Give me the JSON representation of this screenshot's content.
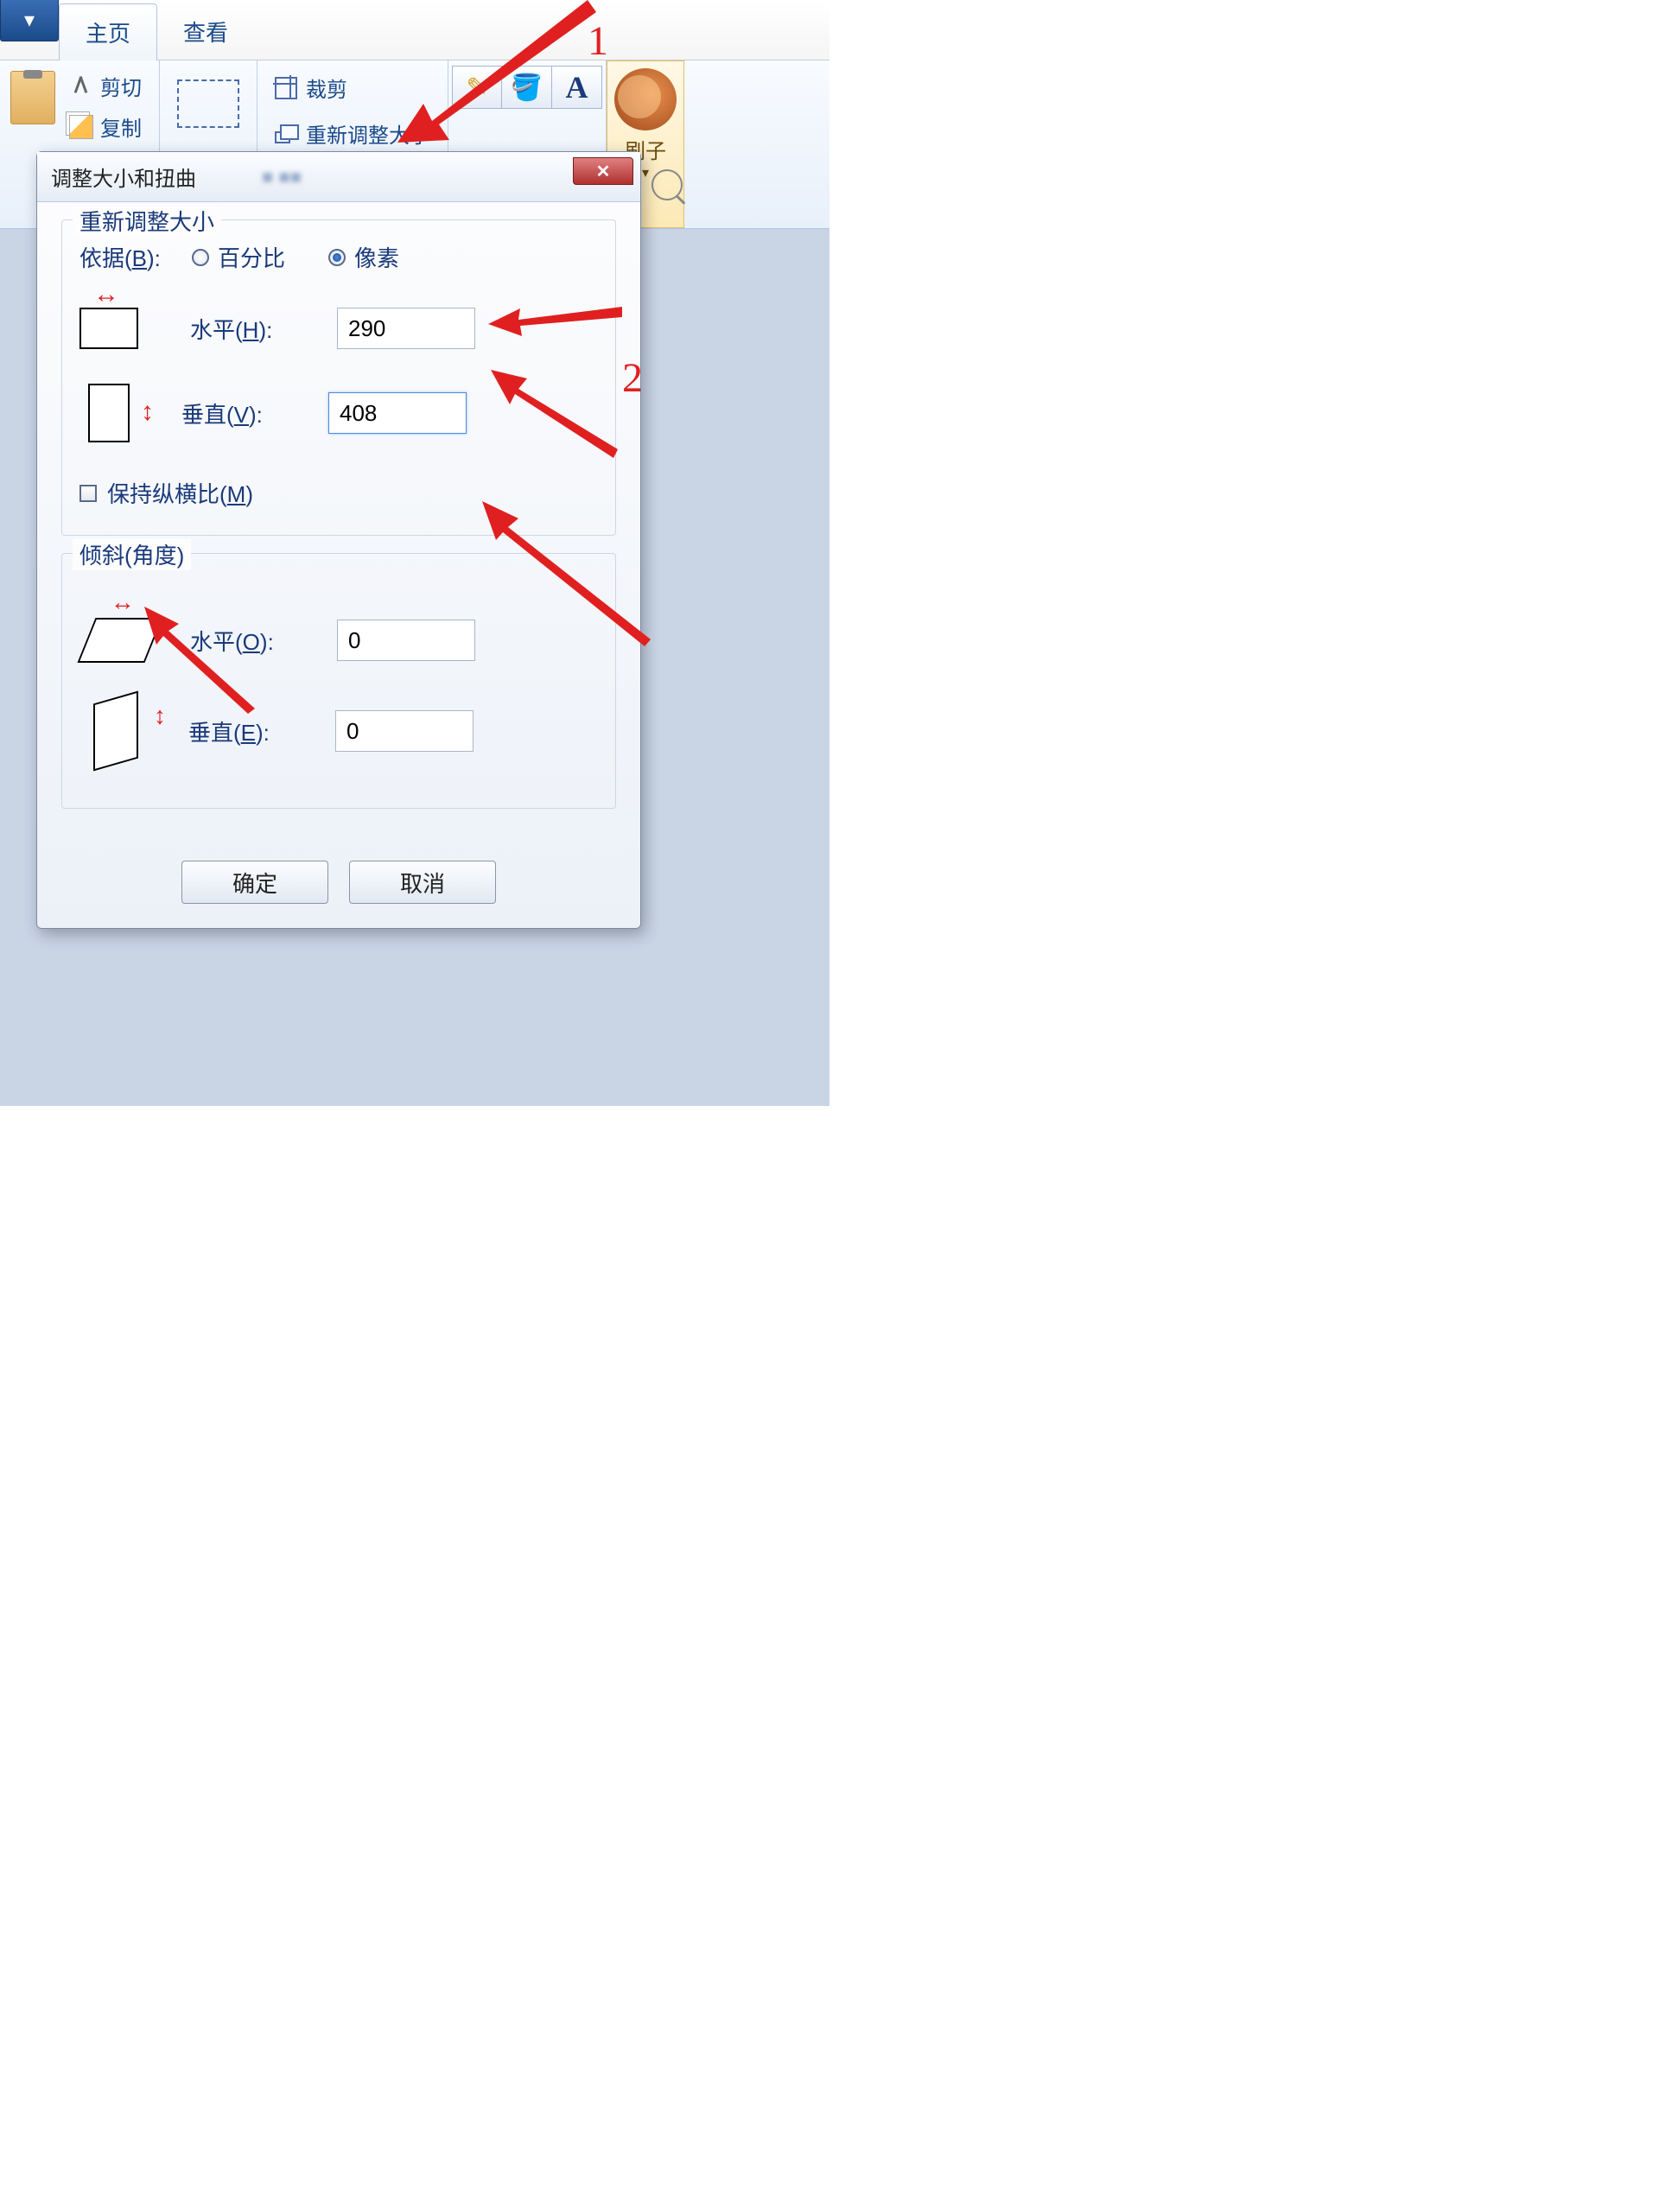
{
  "ribbon": {
    "tabs": {
      "home": "主页",
      "view": "查看"
    },
    "clipboard": {
      "cut": "剪切",
      "copy": "复制"
    },
    "image": {
      "crop": "裁剪",
      "resize": "重新调整大小"
    },
    "brushes_label": "刷子"
  },
  "dialog": {
    "title": "调整大小和扭曲",
    "resize": {
      "legend": "重新调整大小",
      "by_label": "依据(B):",
      "percent_label": "百分比",
      "pixels_label": "像素",
      "horizontal_label": "水平(H):",
      "vertical_label": "垂直(V):",
      "horizontal_value": "290",
      "vertical_value": "408",
      "aspect_label": "保持纵横比(M)",
      "by_selected": "pixels",
      "aspect_checked": false
    },
    "skew": {
      "legend": "倾斜(角度)",
      "horizontal_label": "水平(O):",
      "vertical_label": "垂直(E):",
      "horizontal_value": "0",
      "vertical_value": "0"
    },
    "ok_label": "确定",
    "cancel_label": "取消"
  },
  "annotations": {
    "one": "1",
    "two": "2"
  }
}
